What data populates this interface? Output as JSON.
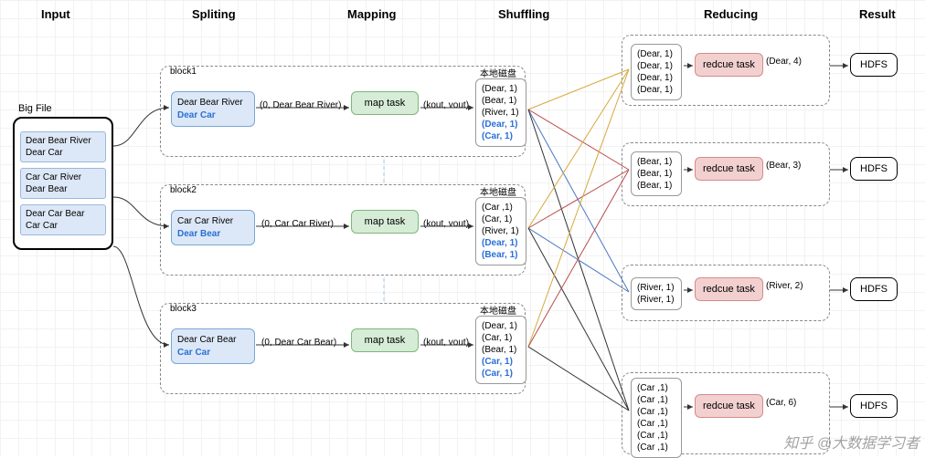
{
  "stages": {
    "input": "Input",
    "splitting": "Spliting",
    "mapping": "Mapping",
    "shuffling": "Shuffling",
    "reducing": "Reducing",
    "result": "Result"
  },
  "input": {
    "big_file_label": "Big File",
    "chunks": [
      {
        "line1": "Dear Bear River",
        "line2": "Dear Car"
      },
      {
        "line1": "Car Car River",
        "line2": "Dear Bear"
      },
      {
        "line1": "Dear Car Bear",
        "line2": "Car Car"
      }
    ]
  },
  "blocks": [
    {
      "label": "block1",
      "split": {
        "line1": "Dear Bear River",
        "line2": "Dear Car"
      },
      "map_label": "map task",
      "edge_in": "(0, Dear Bear River)",
      "edge_out": "(kout, vout)",
      "disk_label": "本地磁盘",
      "kv": {
        "black": [
          "(Dear, 1)",
          "(Bear, 1)",
          "(River, 1)"
        ],
        "blue": [
          "(Dear, 1)",
          "(Car, 1)"
        ]
      }
    },
    {
      "label": "block2",
      "split": {
        "line1": "Car Car River",
        "line2": "Dear Bear"
      },
      "map_label": "map task",
      "edge_in": "(0, Car Car River)",
      "edge_out": "(kout, vout)",
      "disk_label": "本地磁盘",
      "kv": {
        "black": [
          "(Car ,1)",
          "(Car, 1)",
          "(River, 1)"
        ],
        "blue": [
          "(Dear, 1)",
          "(Bear, 1)"
        ]
      }
    },
    {
      "label": "block3",
      "split": {
        "line1": "Dear Car Bear",
        "line2": "Car Car"
      },
      "map_label": "map task",
      "edge_in": "(0, Dear Car Bear)",
      "edge_out": "(kout, vout)",
      "disk_label": "本地磁盘",
      "kv": {
        "black": [
          "(Dear, 1)",
          "(Car, 1)",
          "(Bear, 1)"
        ],
        "blue": [
          "(Car, 1)",
          "(Car, 1)"
        ]
      }
    }
  ],
  "reduces": [
    {
      "group": [
        "(Dear, 1)",
        "(Dear, 1)",
        "(Dear, 1)",
        "(Dear, 1)"
      ],
      "task": "redcue task",
      "out": "(Dear, 4)",
      "result": "HDFS"
    },
    {
      "group": [
        "(Bear, 1)",
        "(Bear, 1)",
        "(Bear, 1)"
      ],
      "task": "redcue task",
      "out": "(Bear, 3)",
      "result": "HDFS"
    },
    {
      "group": [
        "(River, 1)",
        "(River, 1)"
      ],
      "task": "redcue task",
      "out": "(River, 2)",
      "result": "HDFS"
    },
    {
      "group": [
        "(Car ,1)",
        "(Car ,1)",
        "(Car ,1)",
        "(Car ,1)",
        "(Car ,1)",
        "(Car ,1)"
      ],
      "task": "redcue task",
      "out": "(Car, 6)",
      "result": "HDFS"
    }
  ],
  "watermark": "知乎 @大数据学习者"
}
